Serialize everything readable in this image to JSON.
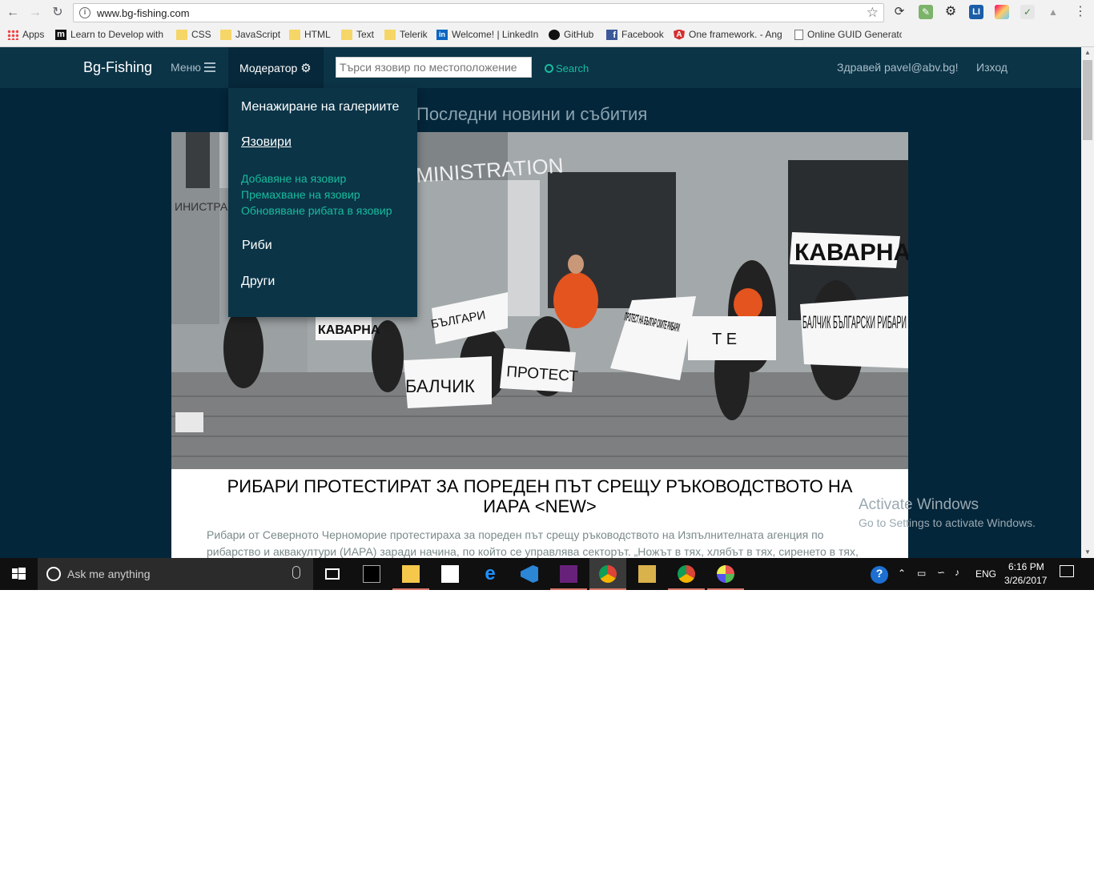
{
  "browser": {
    "url": "www.bg-fishing.com",
    "bookmarks": [
      {
        "label": "Apps",
        "icon": "apps-grid-icon"
      },
      {
        "label": "Learn to Develop with",
        "icon": "m-logo-icon"
      },
      {
        "label": "CSS",
        "icon": "folder-icon"
      },
      {
        "label": "JavaScript",
        "icon": "folder-icon"
      },
      {
        "label": "HTML",
        "icon": "folder-icon"
      },
      {
        "label": "Text",
        "icon": "folder-icon"
      },
      {
        "label": "Telerik",
        "icon": "folder-icon"
      },
      {
        "label": "Welcome! | LinkedIn",
        "icon": "linkedin-icon"
      },
      {
        "label": "GitHub",
        "icon": "github-icon"
      },
      {
        "label": "Facebook",
        "icon": "facebook-icon"
      },
      {
        "label": "One framework. - Ang",
        "icon": "angular-icon"
      },
      {
        "label": "Online GUID Generato",
        "icon": "page-icon"
      }
    ]
  },
  "site": {
    "brand": "Bg-Fishing",
    "menu_label": "Меню",
    "moderator_label": "Модератор",
    "search_placeholder": "Търси язовир по местоположение",
    "search_button": "Search",
    "greeting": "Здравей pavel@abv.bg!",
    "logout": "Изход"
  },
  "dropdown": {
    "galleries": "Менажиране на галериите",
    "dams": "Язовири",
    "add_dam": "Добавяне на язовир",
    "remove_dam": "Премахване на язовир",
    "update_fish": "Обновяване рибата в язовир",
    "fish": "Риби",
    "other": "Други"
  },
  "main": {
    "heading": "Последни новини и събития",
    "article_title": "РИБАРИ ПРОТЕСТИРАТ ЗА ПОРЕДЕН ПЪТ СРЕЩУ РЪКОВОДСТВОТО НА ИАРА <NEW>",
    "article_text": "Рибари от Северното Черноморие протестираха за пореден път срещу ръководството на Изпълнителната агенция по рибарство и аквакултури (ИАРА) заради начина, по който се управлява секторът. „Ножът в тях, хлябът в тях, сиренето в тях,",
    "photo_signs": {
      "building": "MINISTRATION",
      "building_left": "ИНИСТРАЦ",
      "s1": "КАВАРНА",
      "s2": "БЪЛГАРИ",
      "s3": "КАВАРНА",
      "s4": "ПРОТЕСТ НА БЪЛГАР СКИТЕ РИБАРИ",
      "s5": "Т Е",
      "s6": "БАЛЧИК БЪЛГАРСКИ РИБАРИ",
      "s7": "БАЛЧИК",
      "s8": "ПРОТЕСТ"
    }
  },
  "watermark": {
    "line1": "Activate Windows",
    "line2": "Go to Settings to activate Windows."
  },
  "taskbar": {
    "search_placeholder": "Ask me anything",
    "language": "ENG",
    "time": "6:16 PM",
    "date": "3/26/2017"
  },
  "colors": {
    "navbar": "#0b3447",
    "page_bg": "#04263a",
    "accent": "#18bc9c"
  }
}
